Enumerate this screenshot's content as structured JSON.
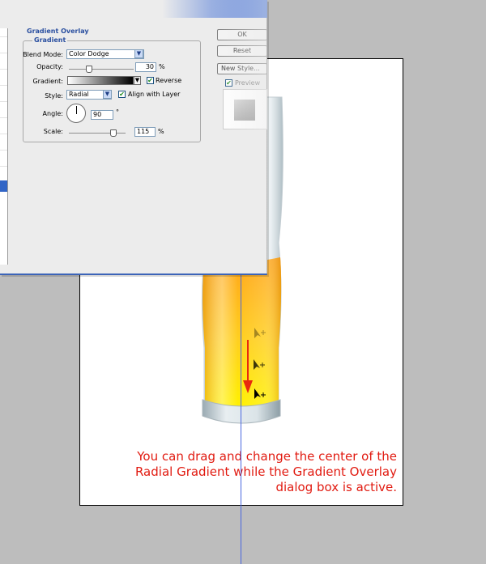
{
  "dialog": {
    "section_title": "Gradient Overlay",
    "group_title": "Gradient",
    "blend_mode_label": "Blend Mode:",
    "blend_mode_value": "Color Dodge",
    "opacity_label": "Opacity:",
    "opacity_value": "30",
    "opacity_fraction": 0.3,
    "percent": "%",
    "gradient_label": "Gradient:",
    "reverse_label": "Reverse",
    "reverse_checked": true,
    "style_label": "Style:",
    "style_value": "Radial",
    "align_label": "Align with Layer",
    "align_checked": true,
    "angle_label": "Angle:",
    "angle_value": "90",
    "degree": "°",
    "scale_label": "Scale:",
    "scale_value": "115",
    "scale_fraction": 0.77
  },
  "buttons": {
    "ok": "OK",
    "reset": "Reset",
    "new_style": "New Style...",
    "preview_label": "Preview",
    "preview_checked": true
  },
  "annotation": {
    "lines": [
      "You can drag and change the center of the",
      "Radial Gradient while the Gradient Overlay",
      "dialog box is active."
    ]
  },
  "colors": {
    "annotation": "#e11a10",
    "guide": "#4a67e0",
    "dialog_accent": "#2a4fa0",
    "beer_top": "#ffb81f",
    "beer_bottom": "#ffee00",
    "arrow": "#e8280f"
  }
}
